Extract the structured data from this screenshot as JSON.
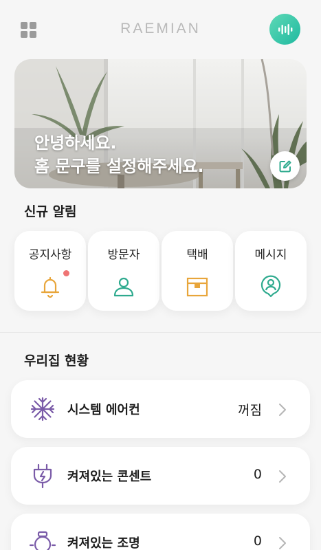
{
  "header": {
    "menu_icon": "grid-icon",
    "brand": "RAEMIAN",
    "voice_icon": "voice-wave-icon",
    "voice_color": "#2cc4a8"
  },
  "banner": {
    "line1": "안녕하세요.",
    "line2": "홈 문구를 설정해주세요.",
    "edit_icon": "edit-icon"
  },
  "alerts": {
    "title": "신규 알림",
    "items": [
      {
        "label": "공지사항",
        "icon": "bell-icon",
        "color": "#e8a53a",
        "has_badge": true
      },
      {
        "label": "방문자",
        "icon": "person-icon",
        "color": "#2eaa8e"
      },
      {
        "label": "택배",
        "icon": "package-icon",
        "color": "#e8a53a"
      },
      {
        "label": "메시지",
        "icon": "message-person-icon",
        "color": "#2eaa8e"
      }
    ]
  },
  "home_status": {
    "title": "우리집 현황",
    "items": [
      {
        "label": "시스템 에어컨",
        "value": "꺼짐",
        "icon": "snowflake-icon"
      },
      {
        "label": "켜져있는 콘센트",
        "value": "0",
        "icon": "plug-icon"
      },
      {
        "label": "켜져있는 조명",
        "value": "0",
        "icon": "lightbulb-icon"
      }
    ],
    "icon_color": "#7a5ba8"
  }
}
